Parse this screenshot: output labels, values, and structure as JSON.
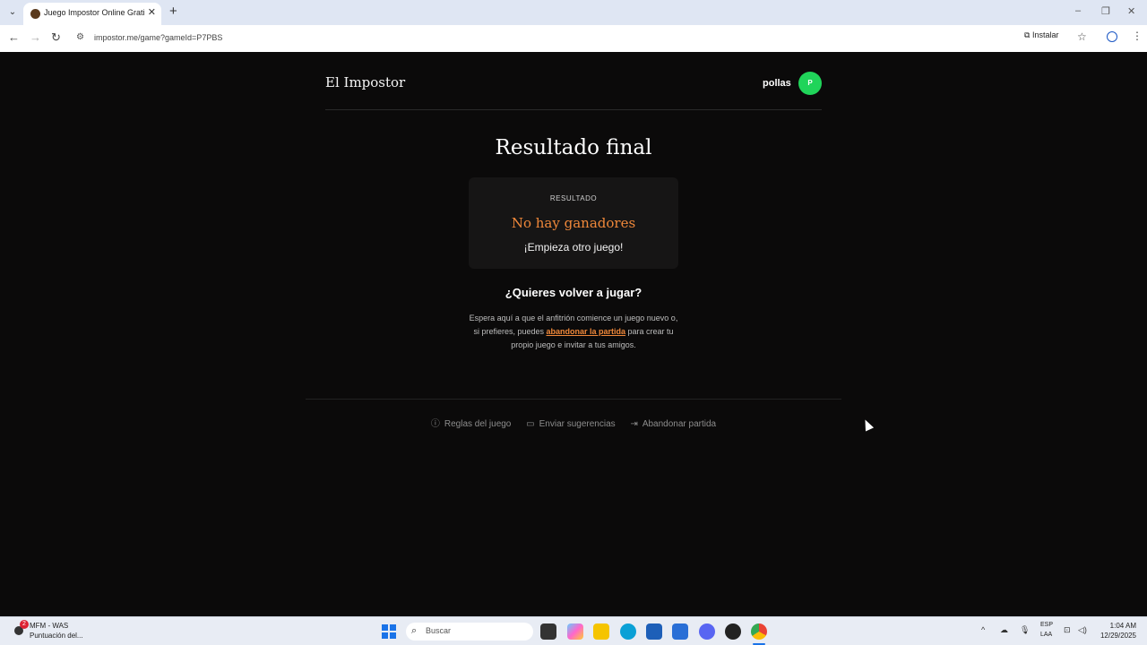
{
  "browser": {
    "tab_title": "Juego Impostor Online Gratis -",
    "url": "impostor.me/game?gameId=P7PBS",
    "install_label": "Instalar"
  },
  "header": {
    "brand": "El Impostor",
    "username": "pollas",
    "avatar_initial": "P",
    "avatar_color": "#20d45a"
  },
  "result": {
    "title": "Resultado final",
    "label": "RESULTADO",
    "winner": "No hay ganadores",
    "subtitle": "¡Empieza otro juego!",
    "accent_color": "#f0883a"
  },
  "replay": {
    "title": "¿Quieres volver a jugar?",
    "text_before": "Espera aquí a que el anfitrión comience un juego nuevo o, si prefieres, puedes ",
    "link_text": "abandonar la partida",
    "text_after": " para crear tu propio juego e invitar a tus amigos."
  },
  "footer": {
    "rules": "Reglas del juego",
    "feedback": "Enviar sugerencias",
    "leave": "Abandonar partida"
  },
  "taskbar": {
    "widget_title": "MFM - WAS",
    "widget_subtitle": "Puntuación del...",
    "badge_count": "2",
    "search_placeholder": "Buscar",
    "lang_top": "ESP",
    "lang_bottom": "LAA",
    "time": "1:04 AM",
    "date": "12/29/2025"
  }
}
